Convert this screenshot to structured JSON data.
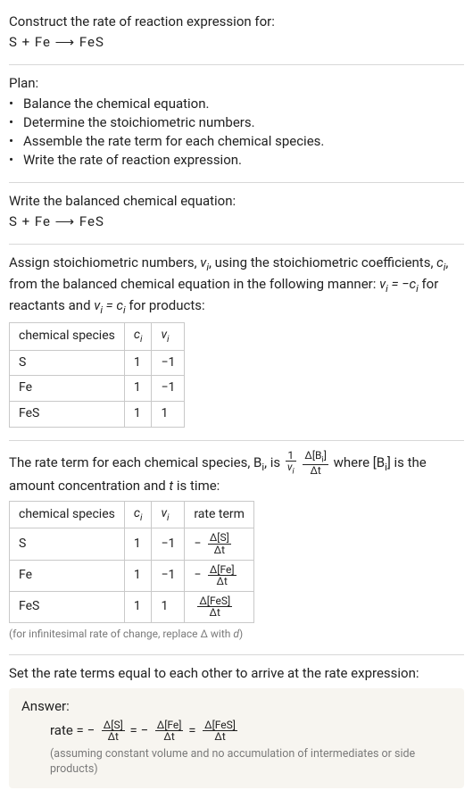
{
  "prompt": {
    "title": "Construct the rate of reaction expression for:",
    "equation": "S + Fe ⟶ FeS"
  },
  "plan": {
    "heading": "Plan:",
    "items": [
      "Balance the chemical equation.",
      "Determine the stoichiometric numbers.",
      "Assemble the rate term for each chemical species.",
      "Write the rate of reaction expression."
    ]
  },
  "balanced": {
    "heading": "Write the balanced chemical equation:",
    "equation": "S + Fe ⟶ FeS"
  },
  "stoich": {
    "text_before": "Assign stoichiometric numbers, ",
    "nu_i": "ν_i",
    "text_mid1": ", using the stoichiometric coefficients, ",
    "c_i": "c_i",
    "text_mid2": ", from the balanced chemical equation in the following manner: ",
    "rule_reactants": "ν_i = −c_i",
    "text_mid3": " for reactants and ",
    "rule_products": "ν_i = c_i",
    "text_mid4": " for products:",
    "columns": {
      "species": "chemical species",
      "c": "c_i",
      "nu": "ν_i"
    },
    "rows": [
      {
        "species": "S",
        "c": "1",
        "nu": "−1"
      },
      {
        "species": "Fe",
        "c": "1",
        "nu": "−1"
      },
      {
        "species": "FeS",
        "c": "1",
        "nu": "1"
      }
    ]
  },
  "rate_terms": {
    "sentence_1": "The rate term for each chemical species, B",
    "sentence_sub": "i",
    "sentence_2": ", is ",
    "frac1_num": "1",
    "frac1_den": "ν_i",
    "frac2_num": "Δ[B_i]",
    "frac2_den": "Δt",
    "sentence_3": " where [B",
    "sentence_3b": "] is the amount concentration and ",
    "t_var": "t",
    "sentence_4": " is time:",
    "columns": {
      "species": "chemical species",
      "c": "c_i",
      "nu": "ν_i",
      "term": "rate term"
    },
    "rows": [
      {
        "species": "S",
        "c": "1",
        "nu": "−1",
        "term_num": "Δ[S]",
        "term_den": "Δt",
        "neg": "−"
      },
      {
        "species": "Fe",
        "c": "1",
        "nu": "−1",
        "term_num": "Δ[Fe]",
        "term_den": "Δt",
        "neg": "−"
      },
      {
        "species": "FeS",
        "c": "1",
        "nu": "1",
        "term_num": "Δ[FeS]",
        "term_den": "Δt",
        "neg": ""
      }
    ],
    "footnote": "(for infinitesimal rate of change, replace Δ with d)"
  },
  "final": {
    "heading": "Set the rate terms equal to each other to arrive at the rate expression:",
    "answer_label": "Answer:",
    "rate_word": "rate = ",
    "t1_neg": "−",
    "t1_num": "Δ[S]",
    "t1_den": "Δt",
    "eq1": " = ",
    "t2_neg": "−",
    "t2_num": "Δ[Fe]",
    "t2_den": "Δt",
    "eq2": " = ",
    "t3_neg": "",
    "t3_num": "Δ[FeS]",
    "t3_den": "Δt",
    "note": "(assuming constant volume and no accumulation of intermediates or side products)"
  }
}
